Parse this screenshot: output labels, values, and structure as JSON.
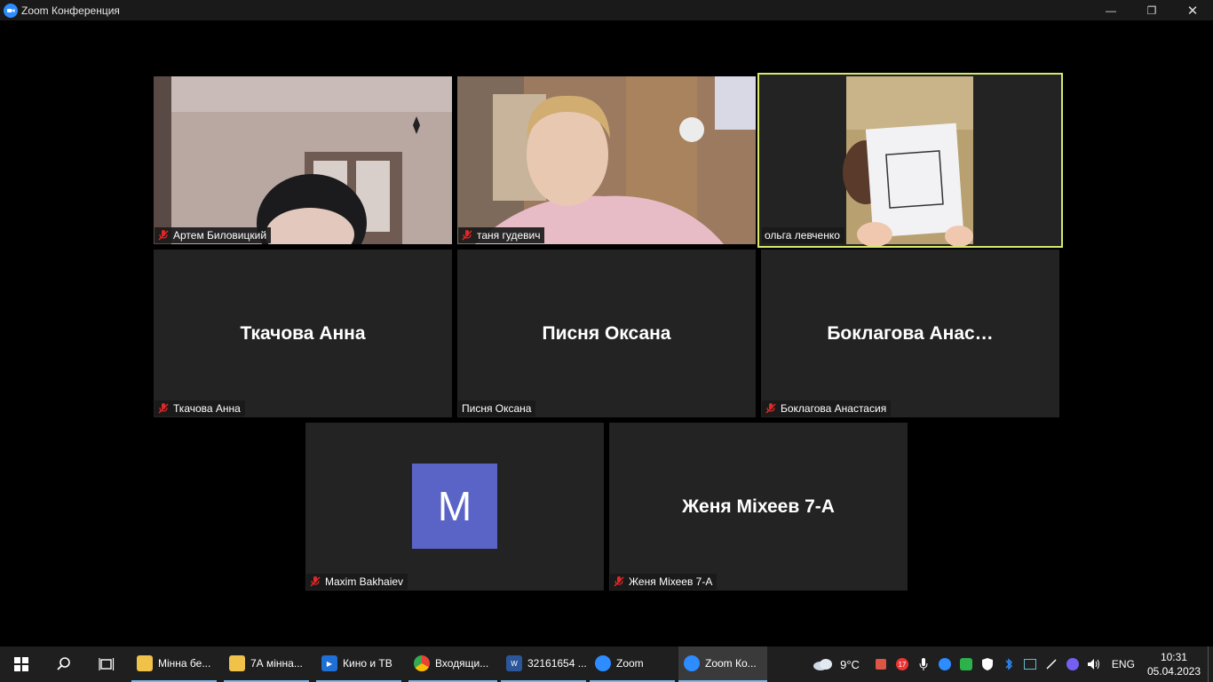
{
  "window": {
    "title": "Zoom Конференция",
    "minimize_icon": "—",
    "maximize_icon": "❐",
    "close_icon": "✕"
  },
  "participants": [
    {
      "name": "Артем Биловицкий",
      "muted": true,
      "video": true
    },
    {
      "name": "таня гудевич",
      "muted": true,
      "video": true
    },
    {
      "name": "ольга левченко",
      "muted": false,
      "video": true,
      "active_speaker": true
    },
    {
      "name": "Ткачова Анна",
      "display": "Ткачова Анна",
      "muted": true,
      "video": false
    },
    {
      "name": "Писня Оксана",
      "display": "Писня Оксана",
      "muted": false,
      "video": false
    },
    {
      "name": "Боклагова Анастасия",
      "display": "Боклагова  Анас…",
      "muted": true,
      "video": false
    },
    {
      "name": "Maxim Bakhaiev",
      "avatar_letter": "M",
      "muted": true,
      "video": false
    },
    {
      "name": "Женя Міхеев 7-А",
      "display": "Женя Міхеев 7-А",
      "muted": true,
      "video": false
    }
  ],
  "taskbar": {
    "apps": [
      {
        "label": "Мінна бе...",
        "icon": "folder-icon"
      },
      {
        "label": "7А мінна...",
        "icon": "folder-icon"
      },
      {
        "label": "Кино и ТВ",
        "icon": "movies-icon"
      },
      {
        "label": "Входящи...",
        "icon": "chrome-icon"
      },
      {
        "label": "32161654 ...",
        "icon": "word-icon"
      },
      {
        "label": "Zoom",
        "icon": "zoom-icon"
      },
      {
        "label": "Zoom Ко...",
        "icon": "zoom-icon"
      }
    ],
    "weather": "9°C",
    "language": "ENG",
    "time": "10:31",
    "date": "05.04.2023",
    "badge_count": "17"
  },
  "colors": {
    "active_border": "#d8e86c",
    "avatar_bg": "#5a64c6",
    "zoom_blue": "#2d8cff"
  }
}
